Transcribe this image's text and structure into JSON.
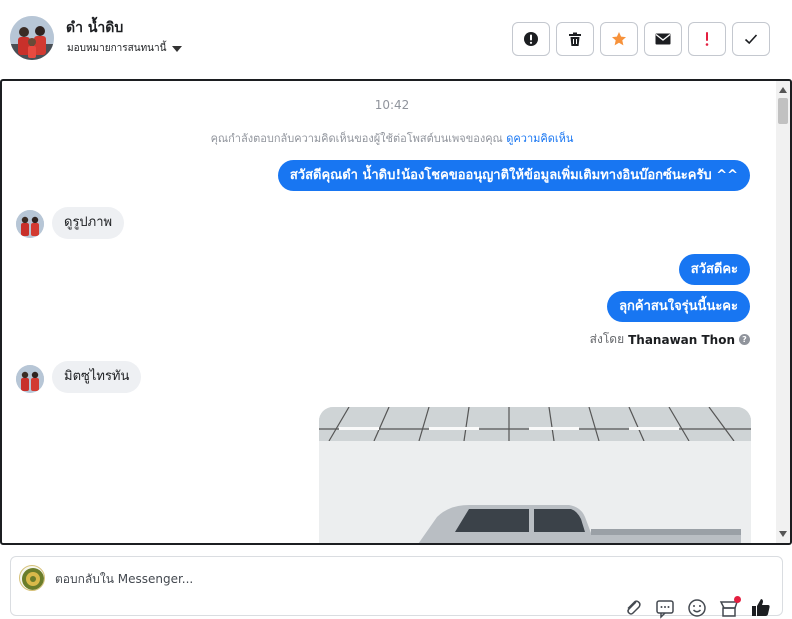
{
  "header": {
    "page_name": "ดำ น้ำดิบ",
    "assign_label": "มอบหมายการสนทนานี้",
    "actions": [
      {
        "name": "spam-button",
        "icon": "exclamation-circle-icon"
      },
      {
        "name": "delete-button",
        "icon": "trash-icon"
      },
      {
        "name": "star-button",
        "icon": "star-icon"
      },
      {
        "name": "mark-unread-button",
        "icon": "envelope-icon"
      },
      {
        "name": "follow-up-button",
        "icon": "red-exclamation-icon"
      },
      {
        "name": "done-button",
        "icon": "checkmark-icon"
      }
    ]
  },
  "conversation": {
    "timestamp": "10:42",
    "notice_text": "คุณกำลังตอบกลับความคิดเห็นของผู้ใช้ต่อโพสต์บนเพจของคุณ",
    "notice_link": "ดูความคิดเห็น",
    "messages": {
      "out_1": "สวัสดีคุณดำ น้ำดิบ!น้องโชคขออนุญาติให้ข้อมูลเพิ่มเติมทางอินบ๊อกซ์นะครับ ^^",
      "in_1": "ดูรูปภาพ",
      "out_2": "สวัสดีคะ",
      "out_3": "ลุกค้าสนใจรุ่นนี้นะคะ",
      "in_2": "มิตซูไทรทัน"
    },
    "sent_by_label": "ส่งโดย",
    "sent_by_name": "Thanawan Thon",
    "info_glyph": "?",
    "photo_alt": "white pickup truck photo"
  },
  "composer": {
    "placeholder": "ตอบกลับใน Messenger...",
    "tools": [
      "attachment-icon",
      "saved-replies-icon",
      "emoji-icon",
      "shop-icon",
      "like-icon"
    ]
  },
  "colors": {
    "accent": "#1876f2",
    "star": "#f7923b",
    "alert": "#e41e3f",
    "incoming_bubble": "#eef0f3"
  }
}
